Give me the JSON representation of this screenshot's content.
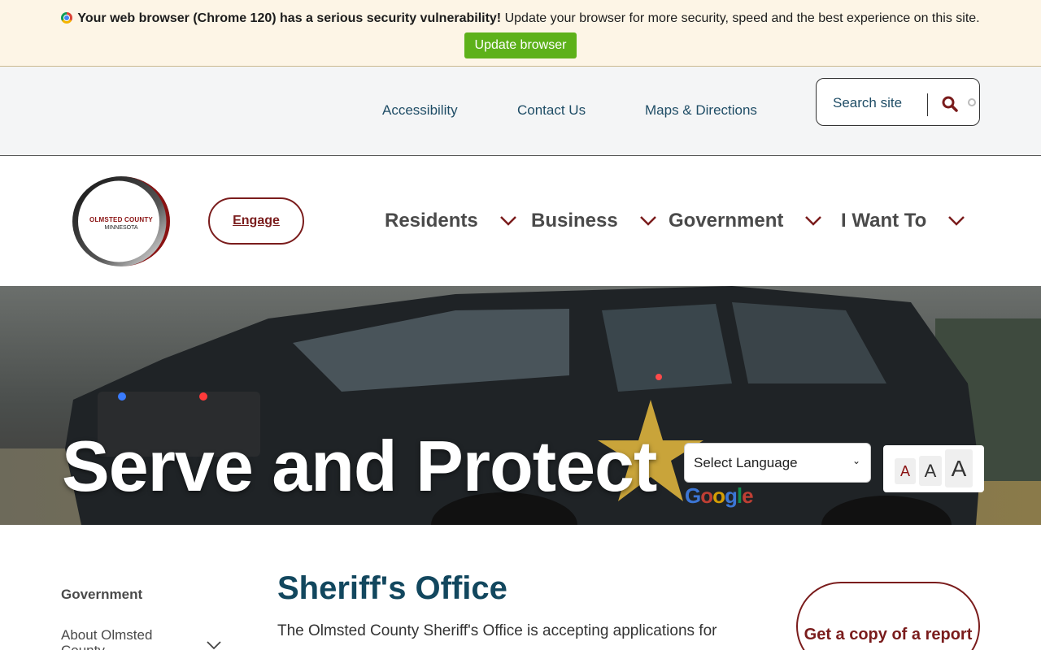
{
  "alert": {
    "bold_text": "Your web browser (Chrome 120) has a serious security vulnerability!",
    "text": "Update your browser for more security, speed and the best experience on this site.",
    "button_label": "Update browser",
    "button_color": "#5db11a"
  },
  "utility_nav": {
    "links": [
      "Accessibility",
      "Contact Us",
      "Maps & Directions"
    ],
    "search_placeholder": "Search site"
  },
  "header": {
    "logo_line1": "OLMSTED COUNTY",
    "logo_line2": "MINNESOTA",
    "engage_label": "Engage",
    "nav": [
      "Residents",
      "Business",
      "Government",
      "I Want To"
    ],
    "accent_color": "#7a1c1c"
  },
  "hero": {
    "title": "Serve and Protect",
    "language_select": "Select Language",
    "google_mark": [
      "G",
      "o",
      "o",
      "g",
      "l",
      "e"
    ],
    "text_size_buttons": [
      "A",
      "A",
      "A"
    ]
  },
  "sidebar": {
    "title": "Government",
    "item": "About Olmsted County"
  },
  "main": {
    "title": "Sheriff's Office",
    "body": "The Olmsted County Sheriff's Office is accepting applications for",
    "title_color": "#12475e"
  },
  "cta": {
    "label": "Get a copy of a report"
  }
}
